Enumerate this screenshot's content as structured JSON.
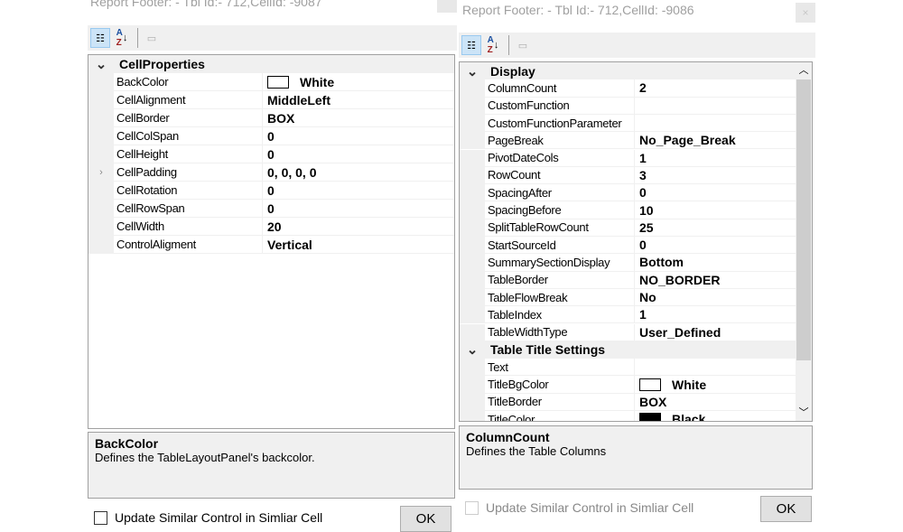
{
  "left": {
    "title": "Report Footer: - Tbl Id:- 712,CellId: -9087",
    "category": "CellProperties",
    "rows": [
      {
        "label": "BackColor",
        "value": "White",
        "swatch": "#ffffff"
      },
      {
        "label": "CellAlignment",
        "value": "MiddleLeft"
      },
      {
        "label": "CellBorder",
        "value": "BOX"
      },
      {
        "label": "CellColSpan",
        "value": "0"
      },
      {
        "label": "CellHeight",
        "value": "0"
      },
      {
        "label": "CellPadding",
        "value": "0, 0, 0, 0",
        "expandable": true
      },
      {
        "label": "CellRotation",
        "value": "0"
      },
      {
        "label": "CellRowSpan",
        "value": "0"
      },
      {
        "label": "CellWidth",
        "value": "20"
      },
      {
        "label": "ControlAligment",
        "value": "Vertical"
      }
    ],
    "desc_title": "BackColor",
    "desc_text": "Defines the TableLayoutPanel's backcolor.",
    "checkbox_label": "Update Similar Control in Simliar Cell",
    "ok_label": "OK"
  },
  "right": {
    "title": "Report Footer: - Tbl Id:- 712,CellId: -9086",
    "close_label": "×",
    "items": [
      {
        "category": "Display"
      },
      {
        "label": "ColumnCount",
        "value": "2"
      },
      {
        "label": "CustomFunction",
        "value": ""
      },
      {
        "label": "CustomFunctionParameter",
        "value": ""
      },
      {
        "label": "PageBreak",
        "value": "No_Page_Break"
      },
      {
        "label": "PivotDateCols",
        "value": "1"
      },
      {
        "label": "RowCount",
        "value": "3"
      },
      {
        "label": "SpacingAfter",
        "value": "0"
      },
      {
        "label": "SpacingBefore",
        "value": "10"
      },
      {
        "label": "SplitTableRowCount",
        "value": "25"
      },
      {
        "label": "StartSourceId",
        "value": "0"
      },
      {
        "label": "SummarySectionDisplay",
        "value": "Bottom"
      },
      {
        "label": "TableBorder",
        "value": "NO_BORDER"
      },
      {
        "label": "TableFlowBreak",
        "value": "No"
      },
      {
        "label": "TableIndex",
        "value": "1"
      },
      {
        "label": "TableWidthType",
        "value": "User_Defined"
      },
      {
        "category": "Table Title Settings"
      },
      {
        "label": "Text",
        "value": ""
      },
      {
        "label": "TitleBgColor",
        "value": "White",
        "swatch": "#ffffff"
      },
      {
        "label": "TitleBorder",
        "value": "BOX"
      },
      {
        "label": "TitleColor",
        "value": "Black",
        "swatch": "#000000"
      }
    ],
    "desc_title": "ColumnCount",
    "desc_text": "Defines the Table Columns",
    "checkbox_label": "Update Similar Control in Simliar Cell",
    "ok_label": "OK"
  },
  "icons": {
    "categorized": "categorized-icon",
    "alphabetical": "sort-az-icon",
    "pages": "property-pages-icon"
  }
}
